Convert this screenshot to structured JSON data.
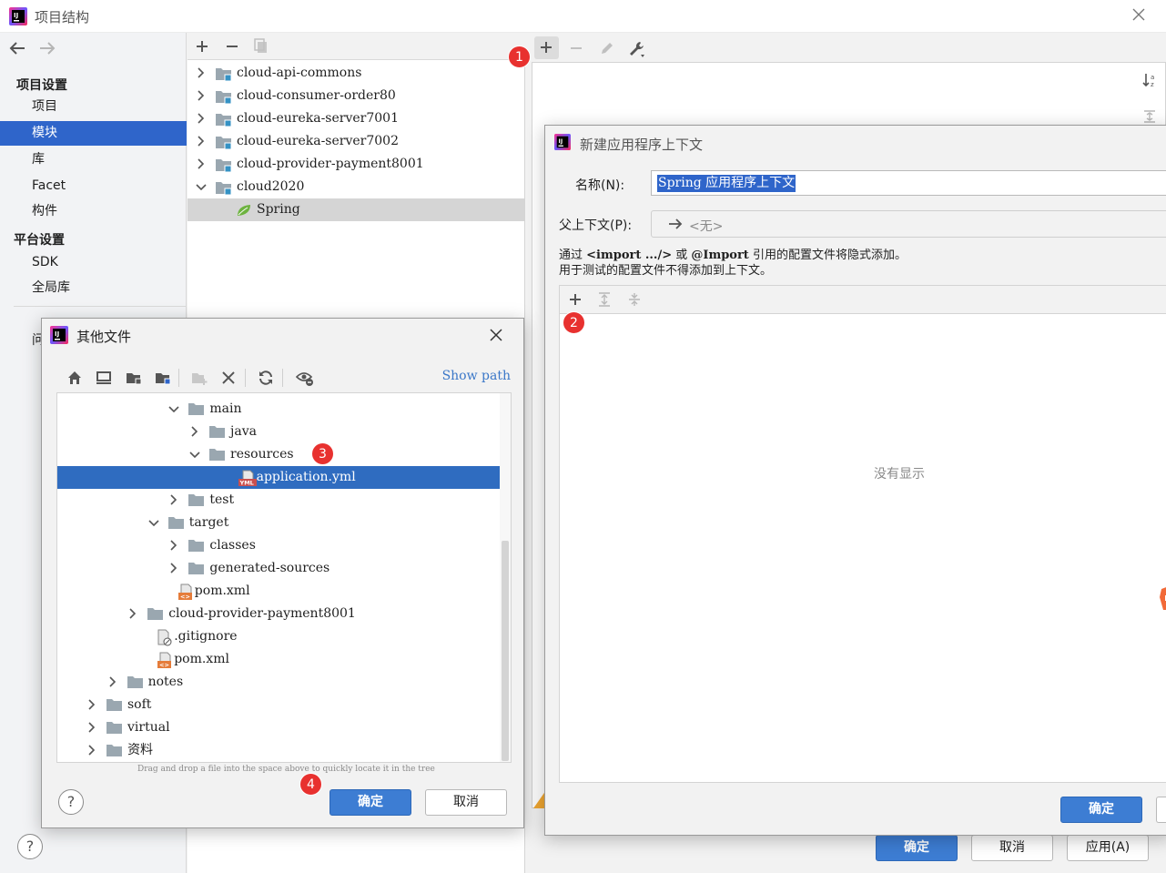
{
  "main_window": {
    "title": "项目结构",
    "nav": {
      "back_icon": "arrow-left-icon",
      "forward_icon": "arrow-right-icon"
    },
    "sidebar": {
      "project_settings_header": "项目设置",
      "project_items": [
        "项目",
        "模块",
        "库",
        "Facet",
        "构件"
      ],
      "selected": "模块",
      "platform_settings_header": "平台设置",
      "platform_items": [
        "SDK",
        "全局库"
      ],
      "problems_partial": "问"
    },
    "modules": [
      {
        "label": "cloud-api-commons",
        "expanded": false
      },
      {
        "label": "cloud-consumer-order80",
        "expanded": false
      },
      {
        "label": "cloud-eureka-server7001",
        "expanded": false
      },
      {
        "label": "cloud-eureka-server7002",
        "expanded": false
      },
      {
        "label": "cloud-provider-payment8001",
        "expanded": false
      },
      {
        "label": "cloud2020",
        "expanded": true
      }
    ],
    "selected_facet": "Spring",
    "footer": {
      "ok": "确定",
      "cancel": "取消",
      "apply": "应用(A)"
    }
  },
  "badges": [
    "1",
    "2",
    "3",
    "4"
  ],
  "spring_dialog": {
    "title": "新建应用程序上下文",
    "name_label": "名称(N):",
    "name_value": "Spring 应用程序上下文",
    "parent_label": "父上下文(P):",
    "parent_value": "<无>",
    "hint_line1_pre": "通过 ",
    "hint_import": "<import .../>",
    "hint_or": " 或 ",
    "hint_annotation": "@Import",
    "hint_line1_post": " 引用的配置文件将隐式添加。",
    "hint_line2": "用于测试的配置文件不得添加到上下文。",
    "empty_text": "没有显示",
    "ok": "确定"
  },
  "file_dialog": {
    "title": "其他文件",
    "show_path": "Show path",
    "tree": [
      {
        "label": "main",
        "level": 5,
        "type": "folder",
        "arrow": "down"
      },
      {
        "label": "java",
        "level": 6,
        "type": "folder",
        "arrow": "right"
      },
      {
        "label": "resources",
        "level": 6,
        "type": "folder",
        "arrow": "down"
      },
      {
        "label": "application.yml",
        "level": 7,
        "type": "yml",
        "arrow": "none",
        "selected": true
      },
      {
        "label": "test",
        "level": 5,
        "type": "folder",
        "arrow": "right"
      },
      {
        "label": "target",
        "level": 4,
        "type": "folder",
        "arrow": "down"
      },
      {
        "label": "classes",
        "level": 5,
        "type": "folder",
        "arrow": "right"
      },
      {
        "label": "generated-sources",
        "level": 5,
        "type": "folder",
        "arrow": "right"
      },
      {
        "label": "pom.xml",
        "level": 4,
        "type": "xml",
        "arrow": "none"
      },
      {
        "label": "cloud-provider-payment8001",
        "level": 3,
        "type": "folder",
        "arrow": "right"
      },
      {
        "label": ".gitignore",
        "level": 3,
        "type": "file",
        "arrow": "none"
      },
      {
        "label": "pom.xml",
        "level": 3,
        "type": "xml",
        "arrow": "none"
      },
      {
        "label": "notes",
        "level": 2,
        "type": "folder",
        "arrow": "right"
      },
      {
        "label": "soft",
        "level": 1,
        "type": "folder",
        "arrow": "right"
      },
      {
        "label": "virtual",
        "level": 1,
        "type": "folder",
        "arrow": "right"
      },
      {
        "label": "资料",
        "level": 1,
        "type": "folder",
        "arrow": "right"
      }
    ],
    "drag_hint": "Drag and drop a file into the space above to quickly locate it in the tree",
    "ok": "确定",
    "cancel": "取消"
  },
  "colors": {
    "accent": "#2f65ca",
    "badge": "#e8312f",
    "selection": "#2f6cc0"
  }
}
